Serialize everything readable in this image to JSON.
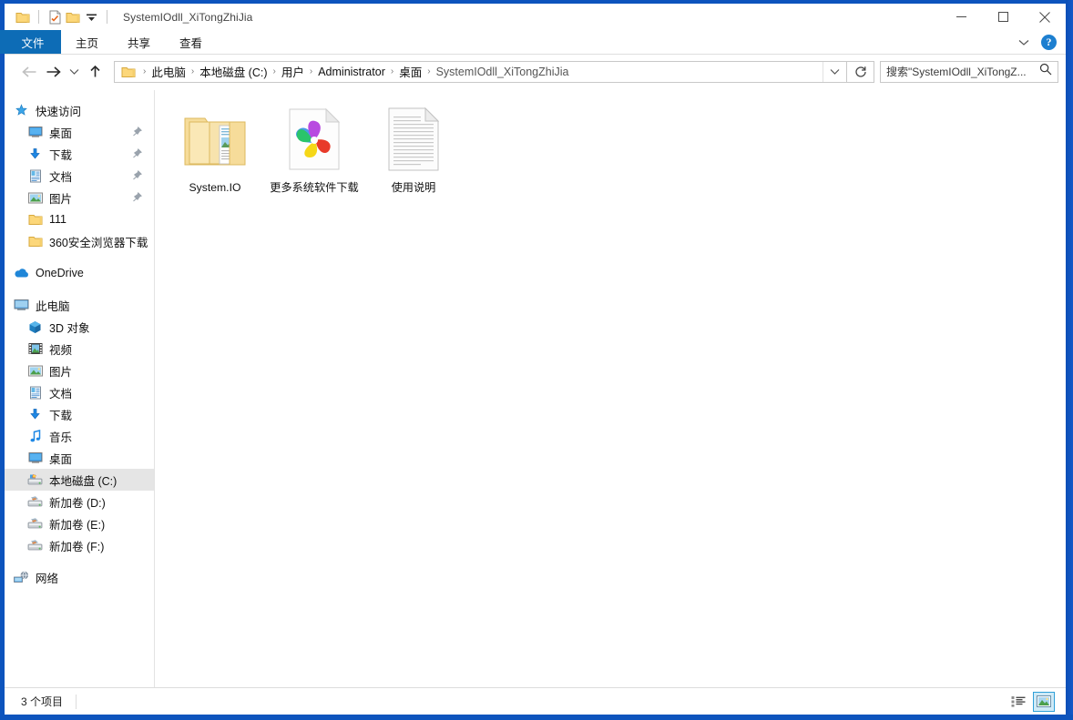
{
  "window": {
    "title": "SystemIOdll_XiTongZhiJia",
    "accent_color": "#0d54bd",
    "quick_access": [
      {
        "name": "folder-icon",
        "label": "文件夹"
      },
      {
        "name": "properties-icon",
        "label": "属性"
      },
      {
        "name": "new-folder-icon",
        "label": "新建文件夹"
      },
      {
        "name": "customize-dropdown-icon",
        "label": "自定义快速访问工具栏"
      }
    ],
    "controls": {
      "minimize": "最小化",
      "maximize": "最大化",
      "close": "关闭"
    }
  },
  "ribbon": {
    "tabs": [
      {
        "label": "文件",
        "active": true
      },
      {
        "label": "主页",
        "active": false
      },
      {
        "label": "共享",
        "active": false
      },
      {
        "label": "查看",
        "active": false
      }
    ],
    "collapse_label": "折叠功能区",
    "help_label": "?"
  },
  "nav": {
    "back_label": "后退",
    "forward_label": "前进",
    "recent_label": "最近浏览的位置",
    "up_label": "上移到",
    "breadcrumbs": [
      {
        "label": "此电脑",
        "dim": false
      },
      {
        "label": "本地磁盘 (C:)",
        "dim": false
      },
      {
        "label": "用户",
        "dim": false
      },
      {
        "label": "Administrator",
        "dim": false
      },
      {
        "label": "桌面",
        "dim": false
      },
      {
        "label": "SystemIOdll_XiTongZhiJia",
        "dim": true
      }
    ],
    "separator": "›",
    "dropdown_label": "历史位置",
    "refresh_label": "刷新"
  },
  "search": {
    "placeholder": "搜索\"SystemIOdll_XiTongZ...",
    "icon": "search-icon"
  },
  "sidebar": {
    "groups": [
      {
        "header": {
          "label": "快速访问",
          "icon": "pin-star-icon",
          "level": 0
        },
        "items": [
          {
            "label": "桌面",
            "icon": "desktop-icon",
            "level": 1,
            "pinned": true,
            "selected": false
          },
          {
            "label": "下载",
            "icon": "downloads-icon",
            "level": 1,
            "pinned": true,
            "selected": false
          },
          {
            "label": "文档",
            "icon": "documents-icon",
            "level": 1,
            "pinned": true,
            "selected": false
          },
          {
            "label": "图片",
            "icon": "pictures-icon",
            "level": 1,
            "pinned": true,
            "selected": false
          },
          {
            "label": "111",
            "icon": "folder-icon",
            "level": 1,
            "pinned": false,
            "selected": false
          },
          {
            "label": "360安全浏览器下载",
            "icon": "folder-icon",
            "level": 1,
            "pinned": false,
            "selected": false
          }
        ]
      },
      {
        "header": {
          "label": "OneDrive",
          "icon": "onedrive-icon",
          "level": 0
        },
        "items": []
      },
      {
        "header": {
          "label": "此电脑",
          "icon": "this-pc-icon",
          "level": 0
        },
        "items": [
          {
            "label": "3D 对象",
            "icon": "3d-objects-icon",
            "level": 1,
            "pinned": false,
            "selected": false
          },
          {
            "label": "视频",
            "icon": "videos-icon",
            "level": 1,
            "pinned": false,
            "selected": false
          },
          {
            "label": "图片",
            "icon": "pictures-icon",
            "level": 1,
            "pinned": false,
            "selected": false
          },
          {
            "label": "文档",
            "icon": "documents-icon",
            "level": 1,
            "pinned": false,
            "selected": false
          },
          {
            "label": "下载",
            "icon": "downloads-icon",
            "level": 1,
            "pinned": false,
            "selected": false
          },
          {
            "label": "音乐",
            "icon": "music-icon",
            "level": 1,
            "pinned": false,
            "selected": false
          },
          {
            "label": "桌面",
            "icon": "desktop-icon",
            "level": 1,
            "pinned": false,
            "selected": false
          },
          {
            "label": "本地磁盘 (C:)",
            "icon": "system-drive-icon",
            "level": 1,
            "pinned": false,
            "selected": true
          },
          {
            "label": "新加卷 (D:)",
            "icon": "drive-icon",
            "level": 1,
            "pinned": false,
            "selected": false
          },
          {
            "label": "新加卷 (E:)",
            "icon": "drive-icon",
            "level": 1,
            "pinned": false,
            "selected": false
          },
          {
            "label": "新加卷 (F:)",
            "icon": "drive-icon",
            "level": 1,
            "pinned": false,
            "selected": false
          }
        ]
      },
      {
        "header": {
          "label": "网络",
          "icon": "network-icon",
          "level": 0
        },
        "items": []
      }
    ]
  },
  "content": {
    "items": [
      {
        "label": "System.IO",
        "icon": "folder-with-files-icon",
        "type": "folder"
      },
      {
        "label": "更多系统软件下载",
        "icon": "browser-pinwheel-document-icon",
        "type": "shortcut"
      },
      {
        "label": "使用说明",
        "icon": "text-document-icon",
        "type": "document"
      }
    ]
  },
  "status": {
    "item_count": "3 个项目",
    "views": [
      {
        "name": "details-view",
        "label": "详细信息",
        "active": false
      },
      {
        "name": "large-icons-view",
        "label": "大图标",
        "active": true
      }
    ]
  }
}
